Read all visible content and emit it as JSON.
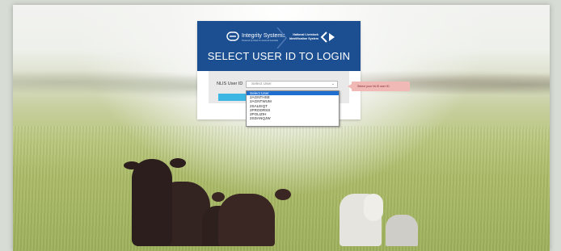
{
  "header": {
    "brand_name": "Integrity Systems",
    "brand_tagline": "Powered by Meat & Livestock Australia",
    "nlis_name_line1": "National Livestock",
    "nlis_name_line2": "Identification System",
    "title": "SELECT USER ID TO LOGIN"
  },
  "form": {
    "label": "NLIS User ID",
    "select_value": "Select User",
    "login_button_label": ""
  },
  "dropdown": {
    "options": [
      "Select User",
      "2AGNTHSE",
      "2AGNTWUM",
      "2SALEIQT",
      "2PRODRSS",
      "2POLIZIH",
      "2SDANQJW"
    ],
    "selected_index": 0
  },
  "tooltip": {
    "text": "Select your NLIS user ID"
  },
  "colors": {
    "banner": "#1c4f92",
    "button": "#3db6e4",
    "tooltip": "#f1b9b6",
    "selected_option": "#1e6fd0"
  }
}
